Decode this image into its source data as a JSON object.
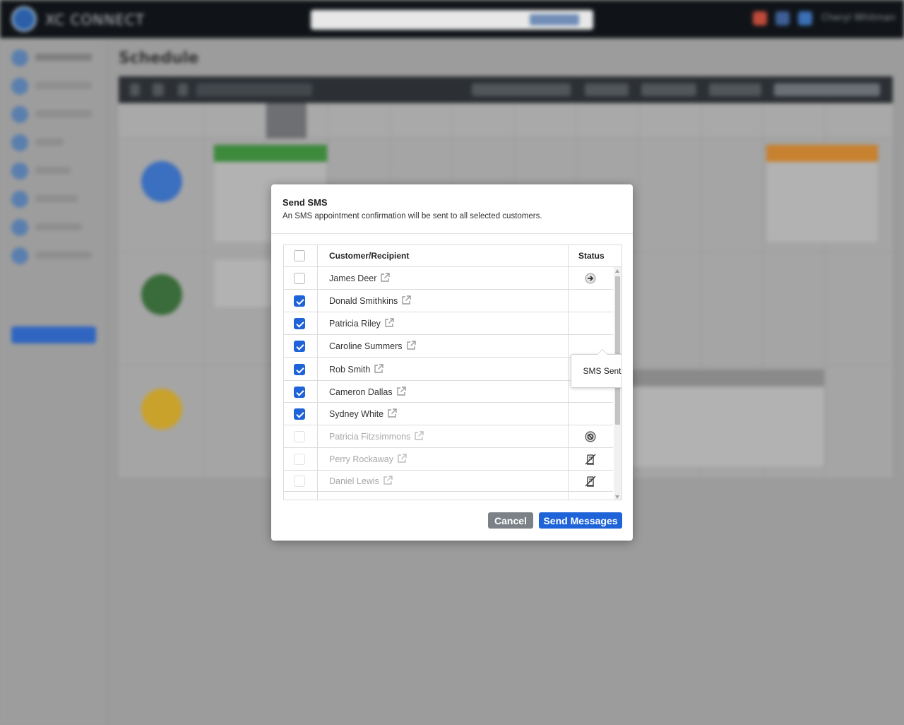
{
  "colors": {
    "primary": "#1e63d8",
    "cancel": "#7b8187",
    "error": "#e0492e",
    "topbar": "#101418"
  },
  "background_app": {
    "brand": "XC CONNECT",
    "user_name": "Cheryl Whitman",
    "page_title": "Schedule"
  },
  "modal": {
    "title": "Send SMS",
    "subtitle": "An SMS appointment confirmation will be sent to all selected customers.",
    "columns": {
      "recipient": "Customer/Recipient",
      "status": "Status"
    },
    "rows": [
      {
        "name": "James Deer",
        "checked": false,
        "disabled": false,
        "status_icon": "arrow-right-icon"
      },
      {
        "name": "Donald Smithkins",
        "checked": true,
        "disabled": false,
        "status_icon": ""
      },
      {
        "name": "Patricia Riley",
        "checked": true,
        "disabled": false,
        "status_icon": ""
      },
      {
        "name": "Caroline Summers",
        "checked": true,
        "disabled": false,
        "status_icon": ""
      },
      {
        "name": "Rob Smith",
        "checked": true,
        "disabled": false,
        "status_icon": "error-x-icon"
      },
      {
        "name": "Cameron Dallas",
        "checked": true,
        "disabled": false,
        "status_icon": ""
      },
      {
        "name": "Sydney White",
        "checked": true,
        "disabled": false,
        "status_icon": ""
      },
      {
        "name": "Patricia Fitzsimmons",
        "checked": false,
        "disabled": true,
        "status_icon": "blocked-icon"
      },
      {
        "name": "Perry Rockaway",
        "checked": false,
        "disabled": true,
        "status_icon": "no-mobile-icon"
      },
      {
        "name": "Daniel Lewis",
        "checked": false,
        "disabled": true,
        "status_icon": "no-mobile-icon"
      }
    ],
    "tooltip": "SMS Sent",
    "cancel_label": "Cancel",
    "send_label": "Send Messages"
  }
}
